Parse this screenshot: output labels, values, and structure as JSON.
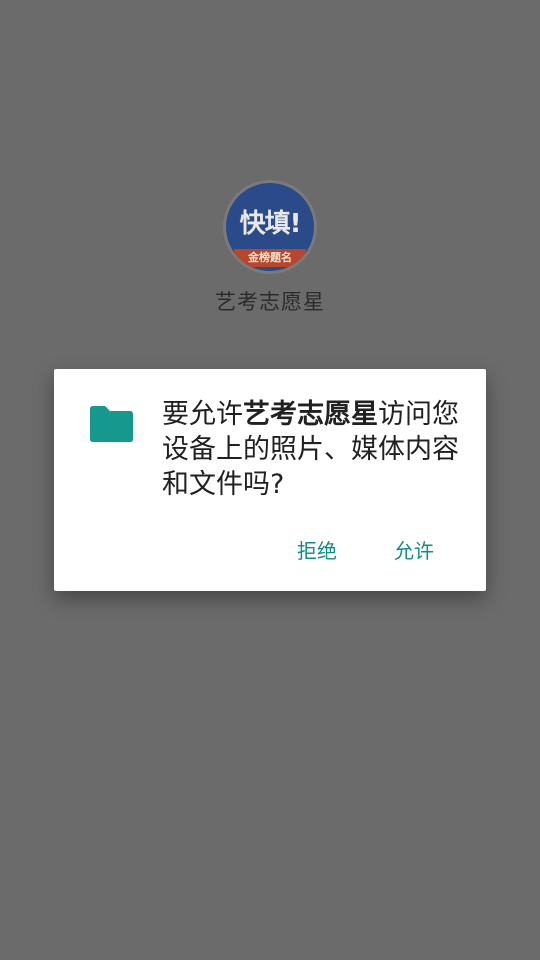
{
  "splash": {
    "logo_main_text": "快填!",
    "logo_ribbon_text": "金榜题名",
    "app_name": "艺考志愿星"
  },
  "dialog": {
    "icon": "folder-icon",
    "message_prefix": "要允许",
    "message_app_name": "艺考志愿星",
    "message_suffix": "访问您设备上的照片、媒体内容和文件吗?",
    "deny_label": "拒绝",
    "allow_label": "允许"
  },
  "colors": {
    "scrim": "#6b6b6b",
    "accent": "#138c86",
    "folder": "#17988e"
  }
}
